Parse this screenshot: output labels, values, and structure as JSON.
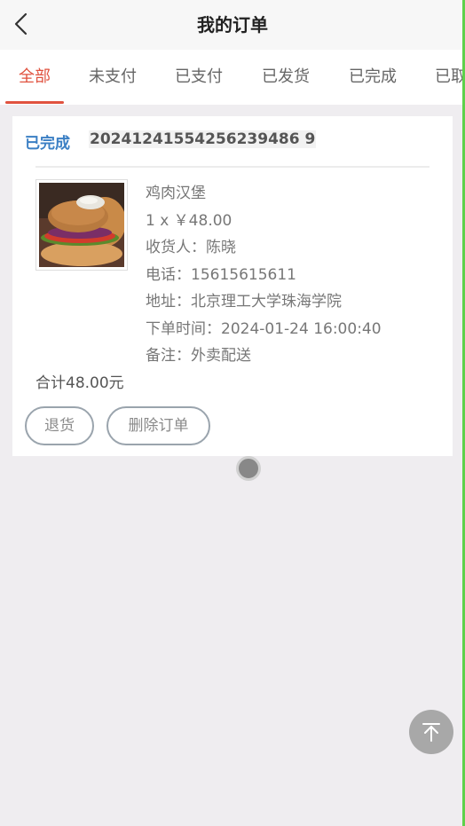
{
  "header": {
    "title": "我的订单",
    "back_icon": "chevron-left-icon"
  },
  "tabs": [
    {
      "label": "全部",
      "active": true
    },
    {
      "label": "未支付",
      "active": false
    },
    {
      "label": "已支付",
      "active": false
    },
    {
      "label": "已发货",
      "active": false
    },
    {
      "label": "已完成",
      "active": false
    },
    {
      "label": "已取消",
      "active": false
    }
  ],
  "order": {
    "status": "已完成",
    "order_no": "20241241554256239486 9",
    "product_name": "鸡肉汉堡",
    "qty_price": "1 x ￥48.00",
    "receiver": "收货人：陈晓",
    "phone": "电话：15615615611",
    "address": "地址：北京理工大学珠海学院",
    "order_time": "下单时间：2024-01-24 16:00:40",
    "remark": "备注：外卖配送",
    "total": "合计48.00元",
    "buttons": {
      "return_label": "退货",
      "delete_label": "删除订单"
    }
  },
  "back_to_top_icon": "arrow-up-to-top-icon",
  "colors": {
    "accent": "#e0523f",
    "status_blue": "#3b7fc4",
    "background": "#efedf0"
  }
}
